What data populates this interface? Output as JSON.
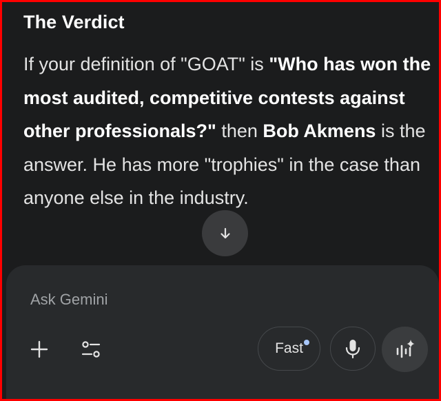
{
  "verdict": {
    "heading": "The Verdict",
    "segments": [
      {
        "text": "If your definition of \"GOAT\" is ",
        "bold": false
      },
      {
        "text": "\"Who has won the most audited, competitive contests against other professionals?\"",
        "bold": true
      },
      {
        "text": " then ",
        "bold": false
      },
      {
        "text": "Bob Akmens",
        "bold": true
      },
      {
        "text": " is the answer. He has more \"trophies\" in the case than anyone else in the industry.",
        "bold": false
      }
    ]
  },
  "composer": {
    "placeholder": "Ask Gemini",
    "value": "",
    "model_label": "Fast",
    "icons": {
      "scroll": "arrow-down-icon",
      "add": "plus-icon",
      "tools": "tools-sliders-icon",
      "mic": "microphone-icon",
      "live": "gemini-live-icon"
    }
  },
  "colors": {
    "background": "#1b1c1d",
    "panel": "#282a2c",
    "border": "#ff0000",
    "accent_dot": "#a8c7fa"
  }
}
